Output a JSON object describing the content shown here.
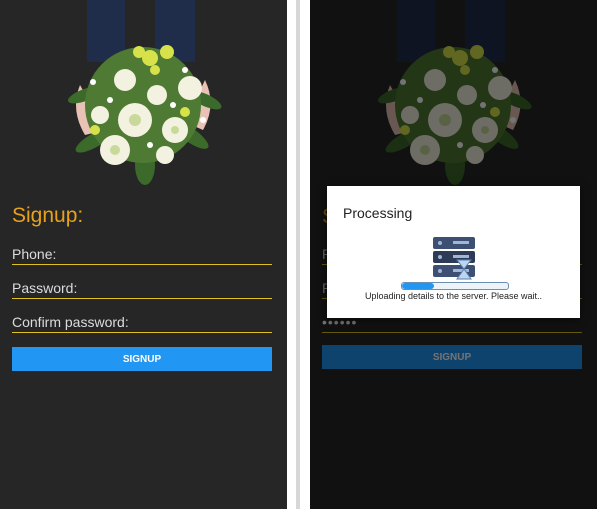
{
  "signup": {
    "title": "Signup:",
    "phone_label": "Phone:",
    "password_label": "Password:",
    "confirm_label": "Confirm password:",
    "button": "SIGNUP",
    "accent": "#e8a21a",
    "button_color": "#2196f3"
  },
  "processing": {
    "title": "Processing",
    "message": "Uploading details to the server. Please wait..",
    "progress": 0.3,
    "password_mask": "••••••",
    "icon": "server-upload-icon"
  }
}
